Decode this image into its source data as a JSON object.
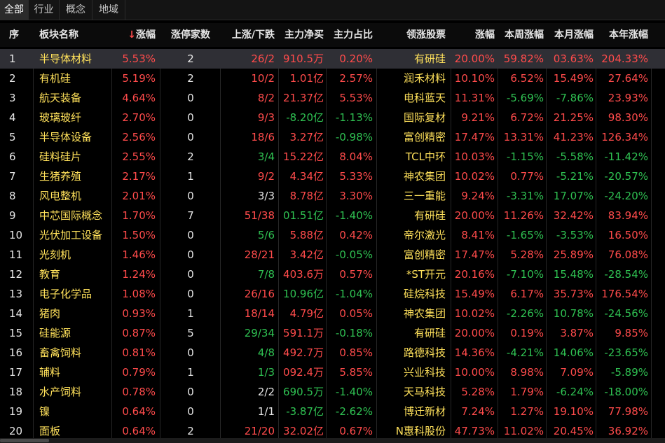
{
  "tabs": [
    {
      "label": "全部",
      "active": true
    },
    {
      "label": "行业",
      "active": false
    },
    {
      "label": "概念",
      "active": false
    },
    {
      "label": "地域",
      "active": false
    }
  ],
  "columns": {
    "seq": "序",
    "name": "板块名称",
    "change_arrow": "↓",
    "change": "涨幅",
    "limit_up": "涨停家数",
    "updown": "上涨/下跌",
    "net": "主力净买",
    "ratio": "主力占比",
    "leader": "领涨股票",
    "leader_change": "涨幅",
    "week": "本周涨幅",
    "month": "本月涨幅",
    "year": "本年涨幅"
  },
  "colors": {
    "up": "#ff4b4b",
    "down": "#2fc152",
    "name": "#ffe15b",
    "text": "#e6e6e6"
  },
  "rows": [
    {
      "seq": "1",
      "name": "半导体材料",
      "change": "5.53%",
      "limit": "2",
      "updown": "26/2",
      "ud_dir": "up",
      "net": "910.5万",
      "net_dir": "up",
      "ratio": "0.20%",
      "ratio_dir": "up",
      "leader": "有研硅",
      "lchg": "20.00%",
      "lchg_dir": "up",
      "week": "59.82%",
      "week_dir": "up",
      "month": "03.63%",
      "month_dir": "up",
      "year": "204.33%",
      "year_dir": "up"
    },
    {
      "seq": "2",
      "name": "有机硅",
      "change": "5.19%",
      "limit": "2",
      "updown": "10/2",
      "ud_dir": "up",
      "net": "1.01亿",
      "net_dir": "up",
      "ratio": "2.57%",
      "ratio_dir": "up",
      "leader": "润禾材料",
      "lchg": "10.10%",
      "lchg_dir": "up",
      "week": "6.52%",
      "week_dir": "up",
      "month": "15.49%",
      "month_dir": "up",
      "year": "27.64%",
      "year_dir": "up"
    },
    {
      "seq": "3",
      "name": "航天装备",
      "change": "4.64%",
      "limit": "0",
      "updown": "8/2",
      "ud_dir": "up",
      "net": "21.37亿",
      "net_dir": "up",
      "ratio": "5.53%",
      "ratio_dir": "up",
      "leader": "电科蓝天",
      "lchg": "11.31%",
      "lchg_dir": "up",
      "week": "-5.69%",
      "week_dir": "down",
      "month": "-7.86%",
      "month_dir": "down",
      "year": "23.93%",
      "year_dir": "up"
    },
    {
      "seq": "4",
      "name": "玻璃玻纤",
      "change": "2.70%",
      "limit": "0",
      "updown": "9/3",
      "ud_dir": "up",
      "net": "-8.20亿",
      "net_dir": "down",
      "ratio": "-1.13%",
      "ratio_dir": "down",
      "leader": "国际复材",
      "lchg": "9.21%",
      "lchg_dir": "up",
      "week": "6.72%",
      "week_dir": "up",
      "month": "21.25%",
      "month_dir": "up",
      "year": "98.30%",
      "year_dir": "up"
    },
    {
      "seq": "5",
      "name": "半导体设备",
      "change": "2.56%",
      "limit": "0",
      "updown": "18/6",
      "ud_dir": "up",
      "net": "3.27亿",
      "net_dir": "up",
      "ratio": "-0.98%",
      "ratio_dir": "down",
      "leader": "富创精密",
      "lchg": "17.47%",
      "lchg_dir": "up",
      "week": "13.31%",
      "week_dir": "up",
      "month": "41.23%",
      "month_dir": "up",
      "year": "126.34%",
      "year_dir": "up"
    },
    {
      "seq": "6",
      "name": "硅料硅片",
      "change": "2.55%",
      "limit": "2",
      "updown": "3/4",
      "ud_dir": "down",
      "net": "15.22亿",
      "net_dir": "up",
      "ratio": "8.04%",
      "ratio_dir": "up",
      "leader": "TCL中环",
      "lchg": "10.03%",
      "lchg_dir": "up",
      "week": "-1.15%",
      "week_dir": "down",
      "month": "-5.58%",
      "month_dir": "down",
      "year": "-11.42%",
      "year_dir": "down"
    },
    {
      "seq": "7",
      "name": "生猪养殖",
      "change": "2.17%",
      "limit": "1",
      "updown": "9/2",
      "ud_dir": "up",
      "net": "4.34亿",
      "net_dir": "up",
      "ratio": "5.33%",
      "ratio_dir": "up",
      "leader": "神农集团",
      "lchg": "10.02%",
      "lchg_dir": "up",
      "week": "0.77%",
      "week_dir": "up",
      "month": "-5.21%",
      "month_dir": "down",
      "year": "-20.57%",
      "year_dir": "down"
    },
    {
      "seq": "8",
      "name": "风电整机",
      "change": "2.01%",
      "limit": "0",
      "updown": "3/3",
      "ud_dir": "flat",
      "net": "8.78亿",
      "net_dir": "up",
      "ratio": "3.30%",
      "ratio_dir": "up",
      "leader": "三一重能",
      "lchg": "9.24%",
      "lchg_dir": "up",
      "week": "-3.31%",
      "week_dir": "down",
      "month": "17.07%",
      "month_dir": "down",
      "year": "-24.20%",
      "year_dir": "down"
    },
    {
      "seq": "9",
      "name": "中芯国际概念",
      "change": "1.70%",
      "limit": "7",
      "updown": "51/38",
      "ud_dir": "up",
      "net": "01.51亿",
      "net_dir": "down",
      "ratio": "-1.40%",
      "ratio_dir": "down",
      "leader": "有研硅",
      "lchg": "20.00%",
      "lchg_dir": "up",
      "week": "11.26%",
      "week_dir": "up",
      "month": "32.42%",
      "month_dir": "up",
      "year": "83.94%",
      "year_dir": "up"
    },
    {
      "seq": "10",
      "name": "光伏加工设备",
      "change": "1.50%",
      "limit": "0",
      "updown": "5/6",
      "ud_dir": "down",
      "net": "5.88亿",
      "net_dir": "up",
      "ratio": "0.42%",
      "ratio_dir": "up",
      "leader": "帝尔激光",
      "lchg": "8.41%",
      "lchg_dir": "up",
      "week": "-1.65%",
      "week_dir": "down",
      "month": "-3.53%",
      "month_dir": "down",
      "year": "16.50%",
      "year_dir": "up"
    },
    {
      "seq": "11",
      "name": "光刻机",
      "change": "1.46%",
      "limit": "0",
      "updown": "28/21",
      "ud_dir": "up",
      "net": "3.42亿",
      "net_dir": "up",
      "ratio": "-0.05%",
      "ratio_dir": "down",
      "leader": "富创精密",
      "lchg": "17.47%",
      "lchg_dir": "up",
      "week": "5.28%",
      "week_dir": "up",
      "month": "25.89%",
      "month_dir": "up",
      "year": "76.08%",
      "year_dir": "up"
    },
    {
      "seq": "12",
      "name": "教育",
      "change": "1.24%",
      "limit": "0",
      "updown": "7/8",
      "ud_dir": "down",
      "net": "403.6万",
      "net_dir": "up",
      "ratio": "0.57%",
      "ratio_dir": "up",
      "leader": "*ST开元",
      "lchg": "20.16%",
      "lchg_dir": "up",
      "week": "-7.10%",
      "week_dir": "down",
      "month": "15.48%",
      "month_dir": "down",
      "year": "-28.54%",
      "year_dir": "down"
    },
    {
      "seq": "13",
      "name": "电子化学品",
      "change": "1.08%",
      "limit": "0",
      "updown": "26/16",
      "ud_dir": "up",
      "net": "10.96亿",
      "net_dir": "down",
      "ratio": "-1.04%",
      "ratio_dir": "down",
      "leader": "硅烷科技",
      "lchg": "15.49%",
      "lchg_dir": "up",
      "week": "6.17%",
      "week_dir": "up",
      "month": "35.73%",
      "month_dir": "up",
      "year": "176.54%",
      "year_dir": "up"
    },
    {
      "seq": "14",
      "name": "猪肉",
      "change": "0.93%",
      "limit": "1",
      "updown": "18/14",
      "ud_dir": "up",
      "net": "4.79亿",
      "net_dir": "up",
      "ratio": "0.05%",
      "ratio_dir": "up",
      "leader": "神农集团",
      "lchg": "10.02%",
      "lchg_dir": "up",
      "week": "-2.26%",
      "week_dir": "down",
      "month": "10.78%",
      "month_dir": "down",
      "year": "-24.56%",
      "year_dir": "down"
    },
    {
      "seq": "15",
      "name": "硅能源",
      "change": "0.87%",
      "limit": "5",
      "updown": "29/34",
      "ud_dir": "down",
      "net": "591.1万",
      "net_dir": "up",
      "ratio": "-0.18%",
      "ratio_dir": "down",
      "leader": "有研硅",
      "lchg": "20.00%",
      "lchg_dir": "up",
      "week": "0.19%",
      "week_dir": "up",
      "month": "3.87%",
      "month_dir": "up",
      "year": "9.85%",
      "year_dir": "up"
    },
    {
      "seq": "16",
      "name": "畜禽饲料",
      "change": "0.81%",
      "limit": "0",
      "updown": "4/8",
      "ud_dir": "down",
      "net": "492.7万",
      "net_dir": "up",
      "ratio": "0.85%",
      "ratio_dir": "up",
      "leader": "路德科技",
      "lchg": "14.36%",
      "lchg_dir": "up",
      "week": "-4.21%",
      "week_dir": "down",
      "month": "14.06%",
      "month_dir": "down",
      "year": "-23.65%",
      "year_dir": "down"
    },
    {
      "seq": "17",
      "name": "辅料",
      "change": "0.79%",
      "limit": "1",
      "updown": "1/3",
      "ud_dir": "down",
      "net": "092.4万",
      "net_dir": "up",
      "ratio": "5.85%",
      "ratio_dir": "up",
      "leader": "兴业科技",
      "lchg": "10.00%",
      "lchg_dir": "up",
      "week": "8.98%",
      "week_dir": "up",
      "month": "7.09%",
      "month_dir": "up",
      "year": "-5.89%",
      "year_dir": "down"
    },
    {
      "seq": "18",
      "name": "水产饲料",
      "change": "0.78%",
      "limit": "0",
      "updown": "2/2",
      "ud_dir": "flat",
      "net": "690.5万",
      "net_dir": "down",
      "ratio": "-1.40%",
      "ratio_dir": "down",
      "leader": "天马科技",
      "lchg": "5.28%",
      "lchg_dir": "up",
      "week": "1.79%",
      "week_dir": "up",
      "month": "-6.24%",
      "month_dir": "down",
      "year": "-18.00%",
      "year_dir": "down"
    },
    {
      "seq": "19",
      "name": "镍",
      "change": "0.64%",
      "limit": "0",
      "updown": "1/1",
      "ud_dir": "flat",
      "net": "-3.87亿",
      "net_dir": "down",
      "ratio": "-2.62%",
      "ratio_dir": "down",
      "leader": "博迁新材",
      "lchg": "7.24%",
      "lchg_dir": "up",
      "week": "1.27%",
      "week_dir": "up",
      "month": "19.10%",
      "month_dir": "up",
      "year": "77.98%",
      "year_dir": "up"
    },
    {
      "seq": "20",
      "name": "面板",
      "change": "0.64%",
      "limit": "2",
      "updown": "21/20",
      "ud_dir": "up",
      "net": "32.02亿",
      "net_dir": "up",
      "ratio": "0.67%",
      "ratio_dir": "up",
      "leader": "N惠科股份",
      "lchg": "47.73%",
      "lchg_dir": "up",
      "week": "11.02%",
      "week_dir": "up",
      "month": "20.45%",
      "month_dir": "up",
      "year": "36.92%",
      "year_dir": "up"
    }
  ]
}
